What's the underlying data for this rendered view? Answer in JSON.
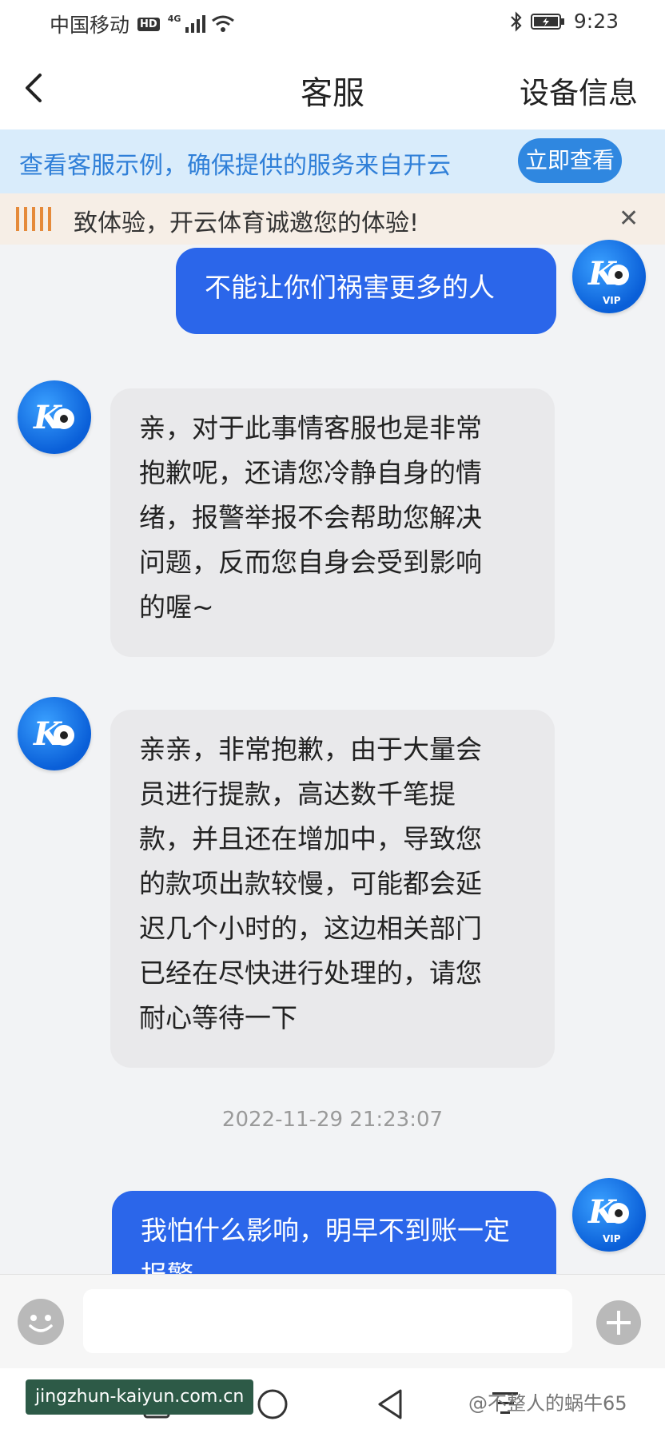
{
  "status_bar": {
    "carrier": "中国移动",
    "hd": "HD",
    "network": "4G",
    "time": "9:23"
  },
  "nav": {
    "title": "客服",
    "right_action": "设备信息"
  },
  "notice": {
    "text": "查看客服示例，确保提供的服务来自开云",
    "button": "立即查看"
  },
  "marquee": {
    "text": "致体验，开云体育诚邀您的体验!"
  },
  "messages": [
    {
      "side": "out",
      "text": "不能让你们祸害更多的人"
    },
    {
      "side": "in",
      "lines": [
        "亲，对于此事情客服也是非常",
        "抱歉呢，还请您冷静自身的情",
        "绪，报警举报不会帮助您解决",
        "问题，反而您自身会受到影响",
        "的喔~"
      ]
    },
    {
      "side": "in",
      "lines": [
        "亲亲，非常抱歉，由于大量会",
        "员进行提款，高达数千笔提",
        "款，并且还在增加中，导致您",
        "的款项出款较慢，可能都会延",
        "迟几个小时的，这边相关部门",
        "已经在尽快进行处理的，请您",
        "耐心等待一下"
      ]
    },
    {
      "side": "out",
      "text": "我怕什么影响，明早不到账一定报警"
    }
  ],
  "timestamp": "2022-11-29 21:23:07",
  "avatar_agent": {
    "label": "K"
  },
  "avatar_user": {
    "label": "K",
    "badge": "VIP"
  },
  "watermark": {
    "url": "jingzhun-kaiyun.com.cn",
    "user": "@不整人的蜗牛65"
  },
  "colors": {
    "accent": "#2b66ea",
    "notice_bg": "#d9ecfb",
    "bubble_in": "#e9e9eb"
  }
}
